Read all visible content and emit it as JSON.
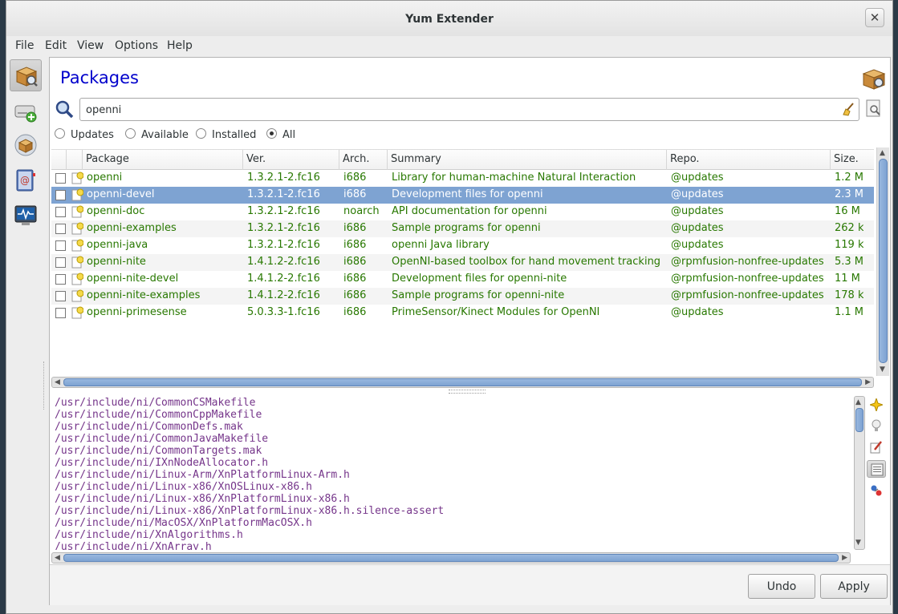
{
  "window": {
    "title": "Yum Extender",
    "close_glyph": "✕"
  },
  "menu": [
    "File",
    "Edit",
    "View",
    "Options",
    "Help"
  ],
  "sidebar": [
    {
      "name": "packages-view-button",
      "icon": "package-search-icon",
      "active": true
    },
    {
      "name": "repositories-view-button",
      "icon": "drive-add-icon",
      "active": false
    },
    {
      "name": "groups-view-button",
      "icon": "package-group-icon",
      "active": false
    },
    {
      "name": "history-view-button",
      "icon": "history-book-icon",
      "active": false
    },
    {
      "name": "output-view-button",
      "icon": "monitor-activity-icon",
      "active": false
    }
  ],
  "page": {
    "title": "Packages"
  },
  "search": {
    "value": "openni",
    "placeholder": ""
  },
  "filters": [
    {
      "label": "Updates",
      "selected": false
    },
    {
      "label": "Available",
      "selected": false
    },
    {
      "label": "Installed",
      "selected": false
    },
    {
      "label": "All",
      "selected": true
    }
  ],
  "columns": {
    "package": "Package",
    "version": "Ver.",
    "arch": "Arch.",
    "summary": "Summary",
    "repo": "Repo.",
    "size": "Size."
  },
  "packages": [
    {
      "name": "openni",
      "version": "1.3.2.1-2.fc16",
      "arch": "i686",
      "summary": "Library for human-machine Natural Interaction",
      "repo": "@updates",
      "size": "1.2 M"
    },
    {
      "name": "openni-devel",
      "version": "1.3.2.1-2.fc16",
      "arch": "i686",
      "summary": "Development files for openni",
      "repo": "@updates",
      "size": "2.3 M"
    },
    {
      "name": "openni-doc",
      "version": "1.3.2.1-2.fc16",
      "arch": "noarch",
      "summary": "API documentation for openni",
      "repo": "@updates",
      "size": "16 M"
    },
    {
      "name": "openni-examples",
      "version": "1.3.2.1-2.fc16",
      "arch": "i686",
      "summary": "Sample programs for openni",
      "repo": "@updates",
      "size": "262 k"
    },
    {
      "name": "openni-java",
      "version": "1.3.2.1-2.fc16",
      "arch": "i686",
      "summary": "openni Java library",
      "repo": "@updates",
      "size": "119 k"
    },
    {
      "name": "openni-nite",
      "version": "1.4.1.2-2.fc16",
      "arch": "i686",
      "summary": "OpenNI-based toolbox for hand movement tracking",
      "repo": "@rpmfusion-nonfree-updates",
      "size": "5.3 M"
    },
    {
      "name": "openni-nite-devel",
      "version": "1.4.1.2-2.fc16",
      "arch": "i686",
      "summary": "Development files for openni-nite",
      "repo": "@rpmfusion-nonfree-updates",
      "size": "11 M"
    },
    {
      "name": "openni-nite-examples",
      "version": "1.4.1.2-2.fc16",
      "arch": "i686",
      "summary": "Sample programs for openni-nite",
      "repo": "@rpmfusion-nonfree-updates",
      "size": "178 k"
    },
    {
      "name": "openni-primesense",
      "version": "5.0.3.3-1.fc16",
      "arch": "i686",
      "summary": "PrimeSensor/Kinect Modules for OpenNI",
      "repo": "@updates",
      "size": "1.1 M"
    }
  ],
  "selected_package": "openni-devel",
  "files": [
    "/usr/include/ni/CommonCSMakefile",
    "/usr/include/ni/CommonCppMakefile",
    "/usr/include/ni/CommonDefs.mak",
    "/usr/include/ni/CommonJavaMakefile",
    "/usr/include/ni/CommonTargets.mak",
    "/usr/include/ni/IXnNodeAllocator.h",
    "/usr/include/ni/Linux-Arm/XnPlatformLinux-Arm.h",
    "/usr/include/ni/Linux-x86/XnOSLinux-x86.h",
    "/usr/include/ni/Linux-x86/XnPlatformLinux-x86.h",
    "/usr/include/ni/Linux-x86/XnPlatformLinux-x86.h.silence-assert",
    "/usr/include/ni/MacOSX/XnPlatformMacOSX.h",
    "/usr/include/ni/XnAlgorithms.h",
    "/usr/include/ni/XnArray.h"
  ],
  "info_tools": [
    "description-star-icon",
    "updateinfo-bulb-icon",
    "changelog-pencil-icon",
    "filelist-icon",
    "dependencies-icon"
  ],
  "buttons": {
    "undo": "Undo",
    "apply": "Apply"
  },
  "colors": {
    "package_text": "#287800",
    "selection": "#7ea3d2",
    "file_text": "#75358a",
    "title_blue": "#0000cc"
  }
}
